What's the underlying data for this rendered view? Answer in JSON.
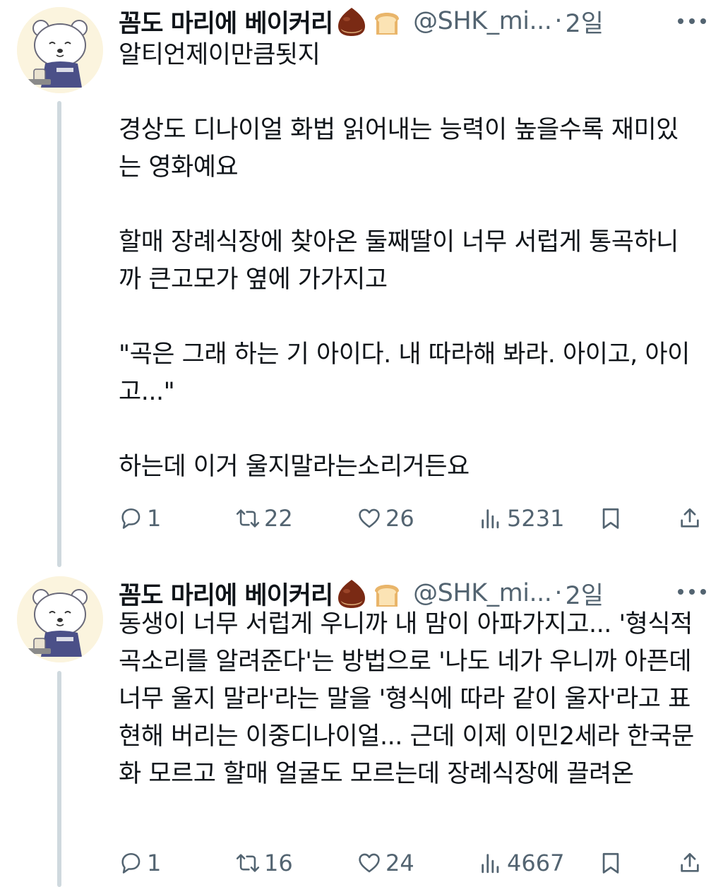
{
  "tweets": [
    {
      "author_name": "꼼도 마리에 베이커리",
      "emojis": [
        "chestnut-icon",
        "bread-icon"
      ],
      "handle": "@SHK_mi...",
      "separator": "·",
      "date": "2일",
      "paragraphs": [
        "알티언제이만큼됫지",
        "경상도 디나이얼 화법 읽어내는 능력이 높을수록 재미있는 영화예요",
        "할매 장례식장에 찾아온 둘째딸이 너무 서럽게 통곡하니까 큰고모가 옆에 가가지고",
        "\"곡은 그래 하는 기 아이다. 내 따라해 봐라. 아이고, 아이고...\"",
        "하는데 이거 울지말라는소리거든요"
      ],
      "replies": "1",
      "retweets": "22",
      "likes": "26",
      "views": "5231"
    },
    {
      "author_name": "꼼도 마리에 베이커리",
      "emojis": [
        "chestnut-icon",
        "bread-icon"
      ],
      "handle": "@SHK_mi...",
      "separator": "·",
      "date": "2일",
      "paragraphs": [
        "동생이 너무 서럽게 우니까 내 맘이 아파가지고... '형식적 곡소리를 알려준다'는 방법으로 '나도 네가 우니까 아픈데 너무 울지 말라'라는 말을 '형식에 따라 같이 울자'라고 표현해 버리는 이중디나이얼... 근데 이제 이민2세라 한국문화 모르고 할매 얼굴도 모르는데 장례식장에 끌려온"
      ],
      "replies": "1",
      "retweets": "16",
      "likes": "24",
      "views": "4667"
    }
  ],
  "colors": {
    "text": "#0f1419",
    "secondary": "#536471",
    "thread_line": "#cfd9de"
  }
}
